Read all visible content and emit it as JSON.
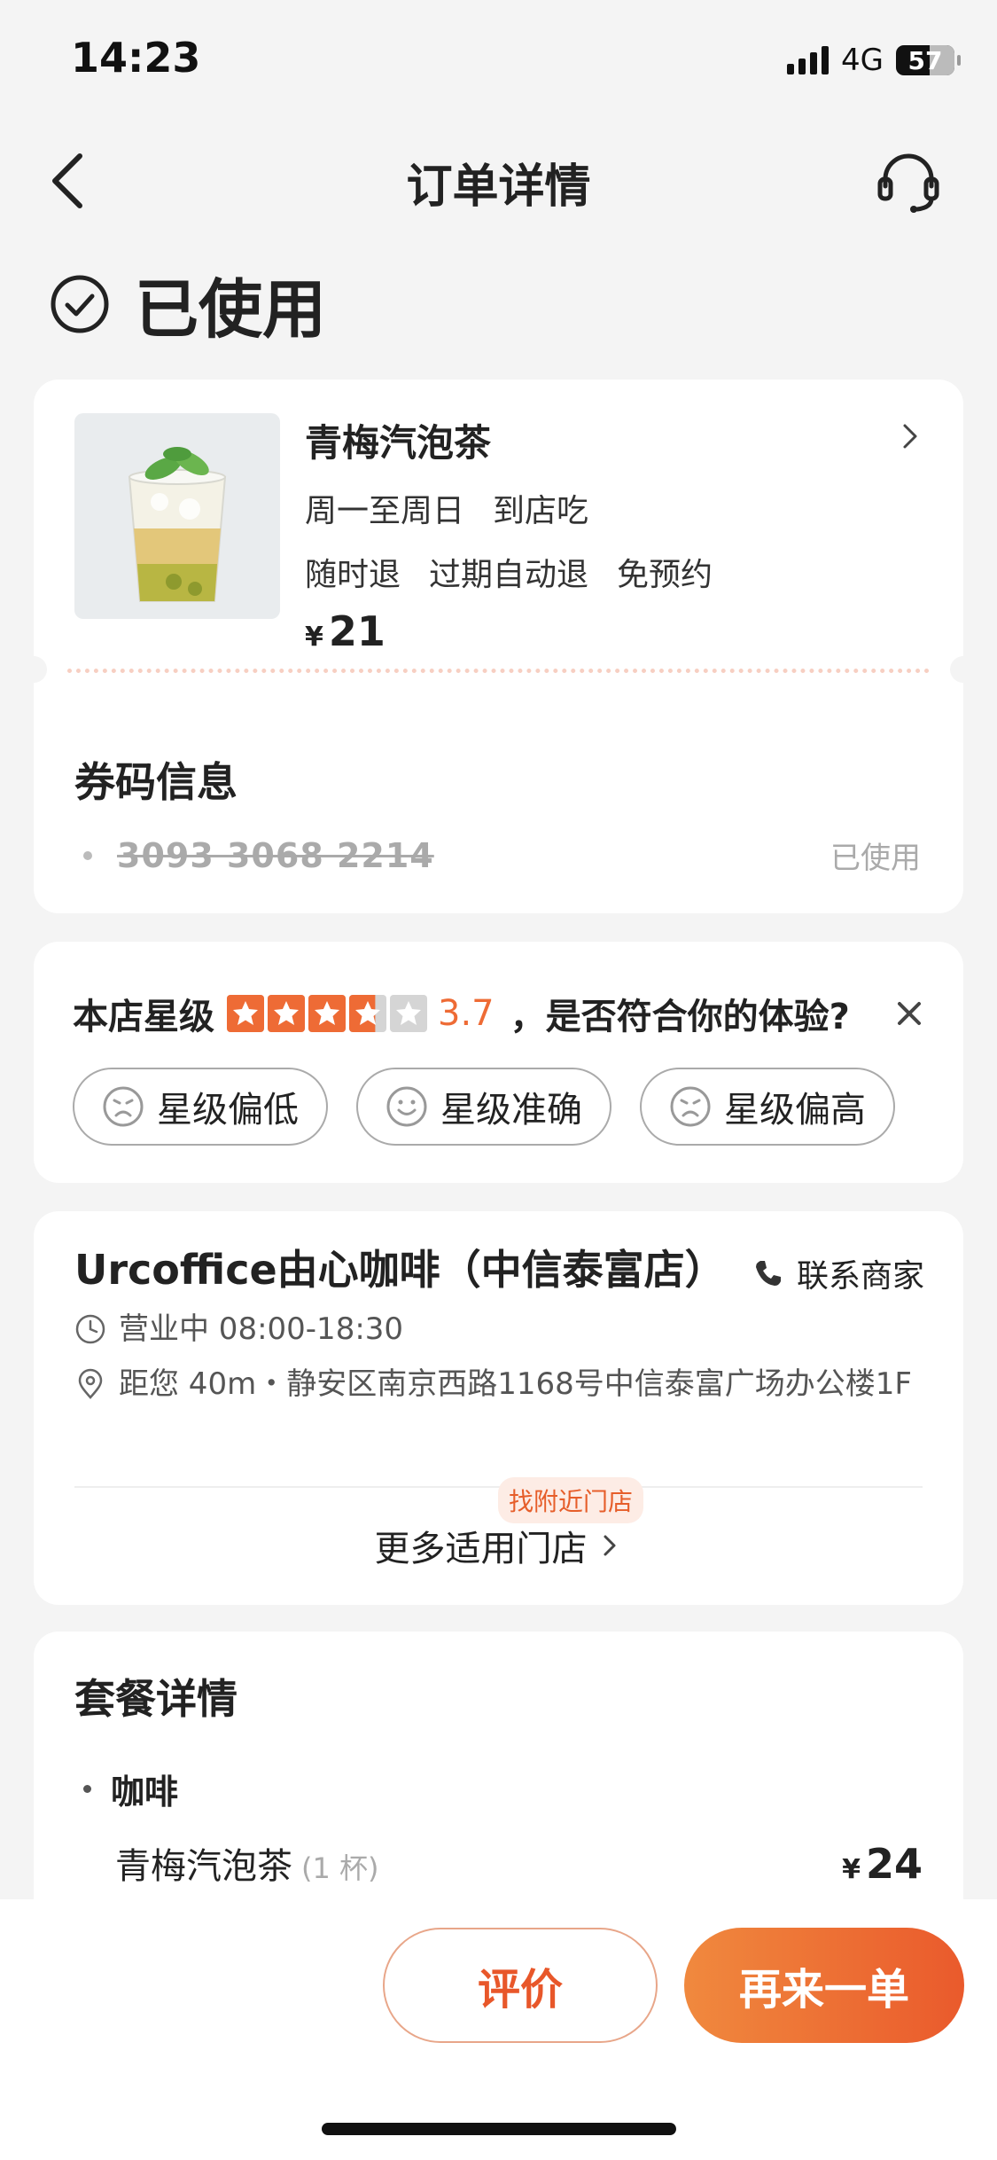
{
  "status_bar": {
    "time": "14:23",
    "network": "4G",
    "battery": "57",
    "battery_level": 0.57
  },
  "nav": {
    "title": "订单详情",
    "back_icon": "back-arrow-icon",
    "service_icon": "headset-icon"
  },
  "order_status": {
    "text": "已使用",
    "icon": "check-circle-icon"
  },
  "product": {
    "name": "青梅汽泡茶",
    "availability": [
      "周一至周日",
      "到店吃"
    ],
    "policies": [
      "随时退",
      "过期自动退",
      "免预约"
    ],
    "price_symbol": "¥",
    "price": "21"
  },
  "coupon": {
    "title": "券码信息",
    "code": "3093 3068 2214",
    "status": "已使用"
  },
  "rating": {
    "label": "本店星级",
    "score": "3.7",
    "stars_value": 3.7,
    "stars_max": 5,
    "question": "，是否符合你的体验?",
    "options": [
      {
        "label": "星级偏低",
        "icon": "frown-face-icon"
      },
      {
        "label": "星级准确",
        "icon": "smile-face-icon"
      },
      {
        "label": "星级偏高",
        "icon": "frown-face-icon"
      }
    ],
    "star_color": "#ee6b35"
  },
  "store": {
    "name": "Urcoffice由心咖啡（中信泰富店）",
    "contact_label": "联系商家",
    "hours": "营业中 08:00-18:30",
    "address": "距您 40m・静安区南京西路1168号中信泰富广场办公楼1F",
    "nearby_tag": "找附近门店",
    "more_label": "更多适用门店"
  },
  "package": {
    "title": "套餐详情",
    "category": "咖啡",
    "item_name": "青梅汽泡茶",
    "item_qty": "(1 杯)",
    "price_symbol": "¥",
    "item_price": "24"
  },
  "actions": {
    "review_label": "评价",
    "reorder_label": "再来一单"
  },
  "colors": {
    "accent": "#ea5a2c",
    "accent_light": "#f0893e"
  }
}
